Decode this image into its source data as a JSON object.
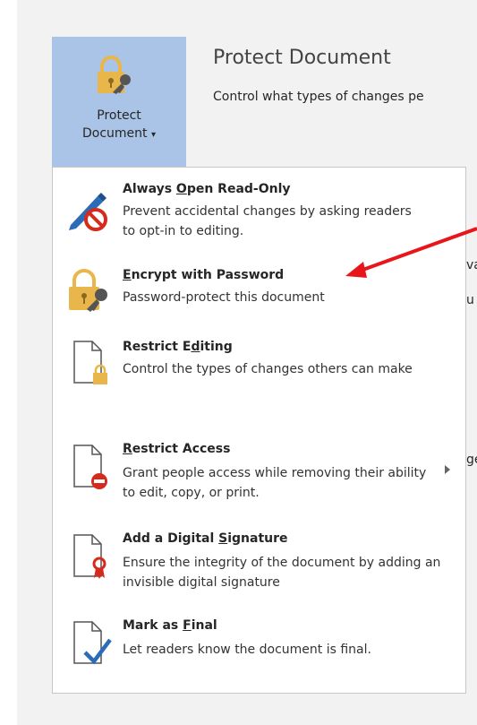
{
  "button": {
    "label_line1": "Protect",
    "label_line2": "Document",
    "dropdown_glyph": "▾"
  },
  "header": {
    "title": "Protect Document",
    "subtitle": "Control what types of changes pe"
  },
  "background_fragments": [
    "va",
    "u",
    "ge"
  ],
  "menu": {
    "items": [
      {
        "id": "always-open-read-only",
        "title_pre": "Always ",
        "title_u": "O",
        "title_post": "pen Read-Only",
        "desc": "Prevent accidental changes by asking readers to opt-in to editing.",
        "icon": "pen-prohibit-icon"
      },
      {
        "id": "encrypt-with-password",
        "title_pre": "",
        "title_u": "E",
        "title_post": "ncrypt with Password",
        "desc": "Password-protect this document",
        "icon": "lock-key-icon"
      },
      {
        "id": "restrict-editing",
        "title_pre": "Restrict E",
        "title_u": "d",
        "title_post": "iting",
        "desc": "Control the types of changes others can make",
        "icon": "document-lock-icon"
      },
      {
        "id": "restrict-access",
        "title_pre": "",
        "title_u": "R",
        "title_post": "estrict Access",
        "desc": "Grant people access while removing their ability to edit, copy, or print.",
        "icon": "document-no-entry-icon"
      },
      {
        "id": "add-digital-signature",
        "title_pre": "Add a Digital ",
        "title_u": "S",
        "title_post": "ignature",
        "desc": "Ensure the integrity of the document by adding an invisible digital signature",
        "icon": "document-ribbon-icon"
      },
      {
        "id": "mark-as-final",
        "title_pre": "Mark as ",
        "title_u": "F",
        "title_post": "inal",
        "desc": "Let readers know the document is final.",
        "icon": "document-checkmark-icon"
      }
    ]
  },
  "colors": {
    "button_bg": "#a9c4e6",
    "annotation_arrow": "#e8151b",
    "prohibit_red": "#d52b1e",
    "lock_gold": "#e8b64a",
    "check_blue": "#2b6cb8"
  }
}
